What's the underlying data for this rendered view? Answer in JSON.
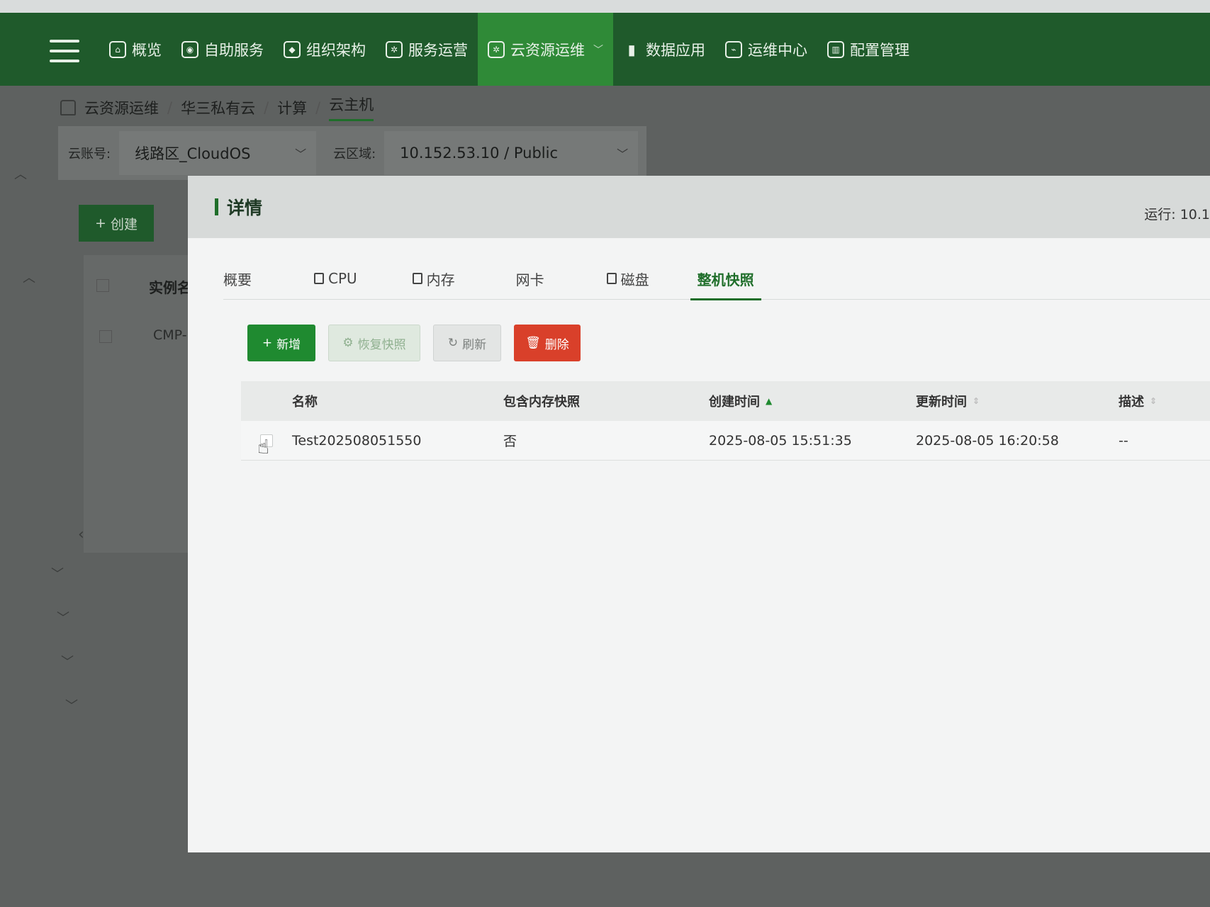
{
  "topbar": {
    "nav": [
      {
        "label": "概览",
        "icon": "home-icon"
      },
      {
        "label": "自助服务",
        "icon": "user-icon"
      },
      {
        "label": "组织架构",
        "icon": "layers-icon"
      },
      {
        "label": "服务运营",
        "icon": "gear-icon"
      },
      {
        "label": "云资源运维",
        "icon": "cloud-ops-icon",
        "active": true,
        "has_dropdown": true
      },
      {
        "label": "数据应用",
        "icon": "bar-chart-icon"
      },
      {
        "label": "运维中心",
        "icon": "monitor-icon"
      },
      {
        "label": "配置管理",
        "icon": "config-icon"
      }
    ]
  },
  "breadcrumb": {
    "items": [
      "云资源运维",
      "华三私有云",
      "计算",
      "云主机"
    ],
    "separator": "/"
  },
  "filters": {
    "account_label": "云账号:",
    "account_value": "线路区_CloudOS",
    "region_label": "云区域:",
    "region_value": "10.152.53.10 / Public"
  },
  "background": {
    "create_label": "创建",
    "column_header": "实例名",
    "row_text": "CMP-k"
  },
  "modal": {
    "title": "详情",
    "status_text": "运行: 10.1",
    "tabs": [
      {
        "label": "概要",
        "icon": null
      },
      {
        "label": "CPU",
        "icon": "cpu-icon"
      },
      {
        "label": "内存",
        "icon": "memory-icon"
      },
      {
        "label": "网卡",
        "icon": null
      },
      {
        "label": "磁盘",
        "icon": "disk-icon"
      },
      {
        "label": "整机快照",
        "icon": null,
        "active": true
      }
    ],
    "toolbar": {
      "new_label": "新增",
      "restore_label": "恢复快照",
      "refresh_label": "刷新",
      "delete_label": "删除"
    },
    "table": {
      "headers": {
        "name": "名称",
        "memory_snapshot": "包含内存快照",
        "created": "创建时间",
        "updated": "更新时间",
        "description": "描述"
      },
      "rows": [
        {
          "name": "Test202508051550",
          "memory_snapshot": "否",
          "created": "2025-08-05 15:51:35",
          "updated": "2025-08-05 16:20:58",
          "description": "--"
        }
      ]
    }
  },
  "colors": {
    "primary": "#1f8a30",
    "nav_bg": "#1f5a2b",
    "danger": "#d9402a"
  }
}
